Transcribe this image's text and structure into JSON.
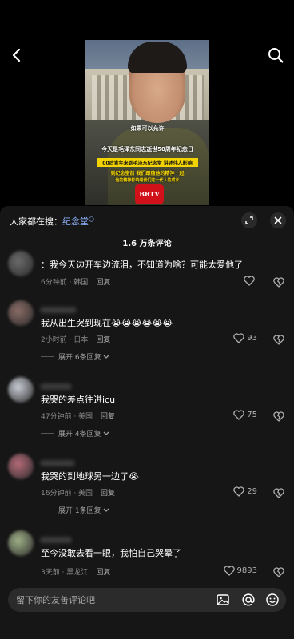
{
  "video": {
    "caption_1": "如果可以允许",
    "caption_2": "今天是毛泽东同志逝世50周年纪念日",
    "caption_3": "00后青年来到毛泽东纪念堂 讲述伟人影响",
    "caption_4": "到纪念堂前 我们跟随他的精神一起",
    "caption_5": "他的精神影响着我们这一代人的成长",
    "mic_logo": "BRTV"
  },
  "sheet": {
    "hot_prefix": "大家都在搜：",
    "hot_link": "纪念堂",
    "count": "1.6 万条评论"
  },
  "comments": [
    {
      "text": "：我今天边开车边流泪，不知道为啥？可能太爱他了",
      "time": "6分钟前 · 韩国",
      "reply": "回复",
      "likes": "",
      "avatar_color": "#6b6b6b"
    },
    {
      "text": "我从出生哭到现在😭😭😭😭😭😭",
      "time": "2小时前 · 日本",
      "reply": "回复",
      "likes": "93",
      "expand": "展开 6条回复",
      "avatar_color": "#8a6c66"
    },
    {
      "text": "我哭的差点往进icu",
      "time": "47分钟前 · 美国",
      "reply": "回复",
      "likes": "75",
      "expand": "展开 4条回复",
      "avatar_color": "#c9ccd6"
    },
    {
      "text": "我哭的到地球另一边了😭",
      "time": "16分钟前 · 美国",
      "reply": "回复",
      "likes": "29",
      "expand": "展开 1条回复",
      "avatar_color": "#b46a78"
    },
    {
      "text": "至今没敢去看一眼，我怕自己哭晕了",
      "time": "3天前 · 黑龙江",
      "reply": "回复",
      "likes": "9893",
      "avatar_color": "#9fb087"
    }
  ],
  "input": {
    "placeholder": "留下你的友善评论吧"
  }
}
